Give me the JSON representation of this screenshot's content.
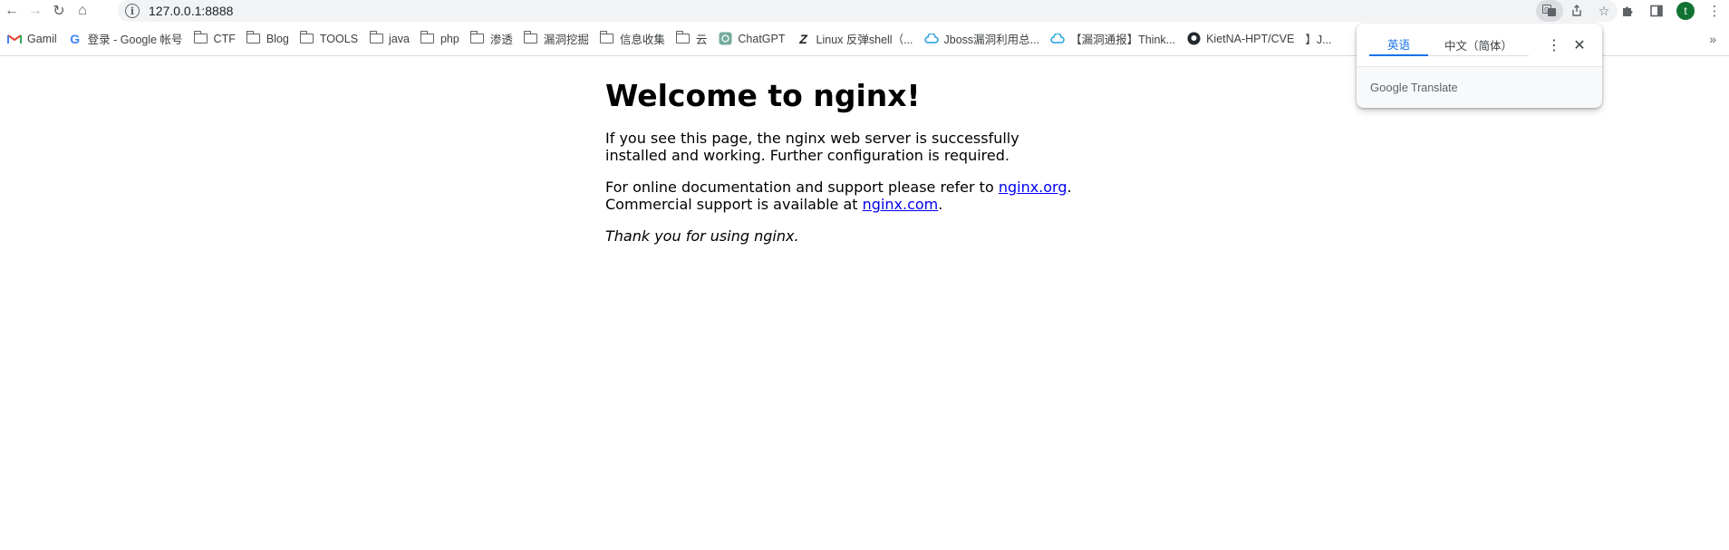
{
  "toolbar": {
    "back_icon": "←",
    "forward_icon": "→",
    "reload_icon": "↻",
    "home_icon": "⌂",
    "url": "127.0.0.1:8888",
    "avatar_letter": "t"
  },
  "bookmarks": [
    {
      "label": "Gamil",
      "icon": "gmail-icon"
    },
    {
      "label": "登录 - Google 帐号",
      "icon": "google-icon"
    },
    {
      "label": "CTF",
      "icon": "folder-icon"
    },
    {
      "label": "Blog",
      "icon": "folder-icon"
    },
    {
      "label": "TOOLS",
      "icon": "folder-icon"
    },
    {
      "label": "java",
      "icon": "folder-icon"
    },
    {
      "label": "php",
      "icon": "folder-icon"
    },
    {
      "label": "渗透",
      "icon": "folder-icon"
    },
    {
      "label": "漏洞挖掘",
      "icon": "folder-icon"
    },
    {
      "label": "信息收集",
      "icon": "folder-icon"
    },
    {
      "label": "云",
      "icon": "folder-icon"
    },
    {
      "label": "ChatGPT",
      "icon": "chatgpt-icon"
    },
    {
      "label": "Linux 反弹shell（...",
      "icon": "slash-icon"
    },
    {
      "label": "Jboss漏洞利用总...",
      "icon": "cloud-icon"
    },
    {
      "label": "【漏洞通报】Think...",
      "icon": "cloud-icon"
    },
    {
      "label": "KietNA-HPT/CVE",
      "icon": "github-icon"
    },
    {
      "label": "】J...",
      "icon": ""
    }
  ],
  "page": {
    "title": "Welcome to nginx!",
    "p1": "If you see this page, the nginx web server is successfully installed and working. Further configuration is required.",
    "p2_text1": "For online documentation and support please refer to ",
    "p2_link1": "nginx.org",
    "p2_text2": ".",
    "p2_text3": "Commercial support is available at ",
    "p2_link2": "nginx.com",
    "p2_text4": ".",
    "p3": "Thank you for using nginx."
  },
  "translate": {
    "tab_source": "英语",
    "tab_target": "中文（简体）",
    "footer_brand": "Google",
    "footer_product": "Translate"
  },
  "colors": {
    "link": "#0000ee",
    "accent": "#1a73e8",
    "avatar_bg": "#137333"
  }
}
